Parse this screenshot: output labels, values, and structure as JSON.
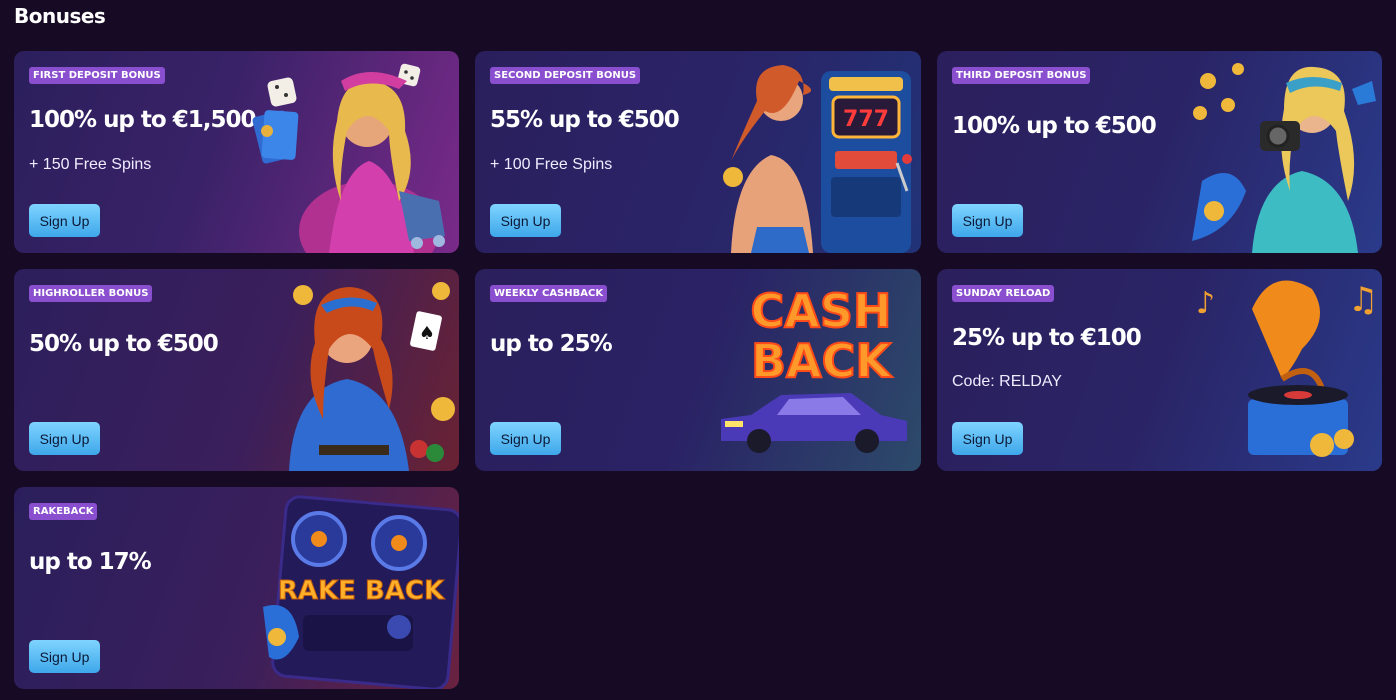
{
  "page": {
    "title": "Bonuses"
  },
  "cards": [
    {
      "badge": "FIRST DEPOSIT BONUS",
      "headline": "100% up to €1,500",
      "sub": "+ 150 Free Spins",
      "button": "Sign Up"
    },
    {
      "badge": "SECOND DEPOSIT BONUS",
      "headline": "55% up to €500",
      "sub": "+ 100 Free Spins",
      "button": "Sign Up"
    },
    {
      "badge": "THIRD DEPOSIT BONUS",
      "headline": "100% up to €500",
      "sub": "",
      "button": "Sign Up"
    },
    {
      "badge": "HIGHROLLER BONUS",
      "headline": "50% up to €500",
      "sub": "",
      "button": "Sign Up"
    },
    {
      "badge": "WEEKLY CASHBACK",
      "headline": "up to 25%",
      "sub": "",
      "button": "Sign Up",
      "art_text": [
        "CASH",
        "BACK"
      ]
    },
    {
      "badge": "SUNDAY RELOAD",
      "headline": "25% up to €100",
      "sub": "Code: RELDAY",
      "button": "Sign Up"
    },
    {
      "badge": "RAKEBACK",
      "headline": "up to 17%",
      "sub": "",
      "button": "Sign Up",
      "art_text": [
        "RAKE BACK"
      ]
    }
  ],
  "icons": {
    "card1": "woman-with-cards-dice-illustration",
    "card2": "woman-slot-machine-illustration",
    "card3": "woman-camera-coins-illustration",
    "card4": "woman-ace-card-chips-illustration",
    "card5": "cashback-car-illustration",
    "card6": "gramophone-music-illustration",
    "card7": "rakeback-tape-deck-illustration"
  }
}
